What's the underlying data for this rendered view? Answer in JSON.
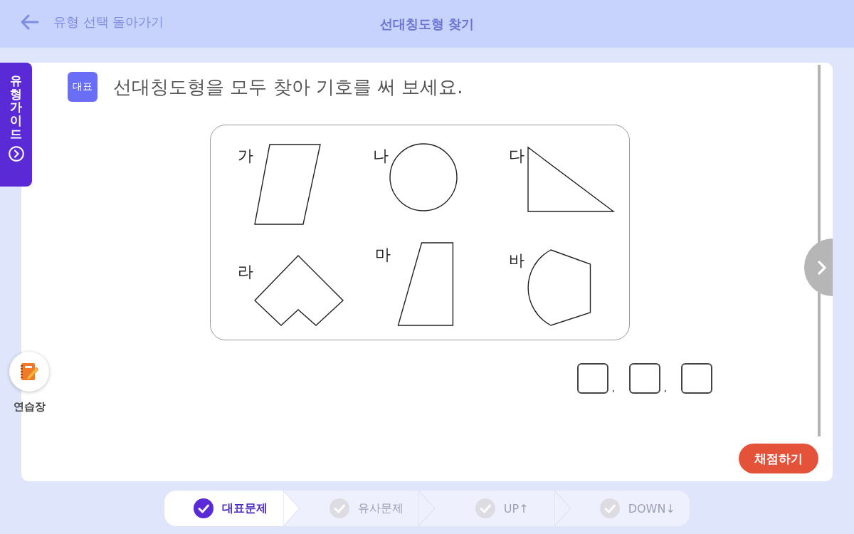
{
  "header": {
    "back_label": "유형 선택 돌아가기",
    "title": "선대칭도형 찾기"
  },
  "guide_tab": {
    "label": "유형 가이드"
  },
  "practice": {
    "label": "연습장"
  },
  "question": {
    "badge": "대표",
    "text": "선대칭도형을 모두 찾아 기호를 써 보세요."
  },
  "figures": [
    {
      "label": "가",
      "kind": "parallelogram"
    },
    {
      "label": "나",
      "kind": "circle"
    },
    {
      "label": "다",
      "kind": "right-triangle"
    },
    {
      "label": "라",
      "kind": "notched"
    },
    {
      "label": "마",
      "kind": "trapezoid"
    },
    {
      "label": "바",
      "kind": "arc-pentagon"
    }
  ],
  "answer_row": [
    {
      "kind": "box"
    },
    {
      "kind": "comma",
      "text": ","
    },
    {
      "kind": "box"
    },
    {
      "kind": "comma",
      "text": ","
    },
    {
      "kind": "box"
    }
  ],
  "submit_button": "채점하기",
  "steps": [
    {
      "label": "대표문제",
      "selected": true
    },
    {
      "label": "유사문제",
      "selected": false
    },
    {
      "label": "UP↑",
      "selected": false
    },
    {
      "label": "DOWN↓",
      "selected": false
    }
  ]
}
